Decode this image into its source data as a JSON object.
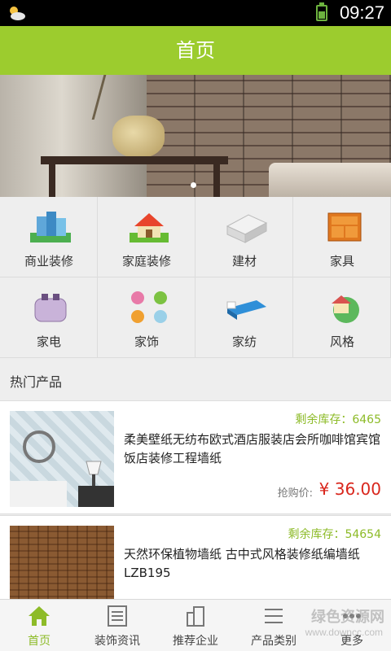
{
  "status_bar": {
    "time": "09:27"
  },
  "header": {
    "title": "首页"
  },
  "categories": [
    {
      "label": "商业装修",
      "icon": "buildings-icon"
    },
    {
      "label": "家庭装修",
      "icon": "house-icon"
    },
    {
      "label": "建材",
      "icon": "building-materials-icon"
    },
    {
      "label": "家具",
      "icon": "cabinet-icon"
    },
    {
      "label": "家电",
      "icon": "toaster-icon"
    },
    {
      "label": "家饰",
      "icon": "tree-art-icon"
    },
    {
      "label": "家纺",
      "icon": "bed-icon"
    },
    {
      "label": "风格",
      "icon": "globe-house-icon"
    }
  ],
  "hot_section": {
    "title": "热门产品"
  },
  "products": [
    {
      "stock": "剩余库存：6465",
      "name": "柔美壁纸无纺布欧式酒店服装店会所咖啡馆宾馆饭店装修工程墙纸",
      "price_label": "抢购价:",
      "price": "¥ 36.00"
    },
    {
      "stock": "剩余库存：54654",
      "name": "天然环保植物墙纸 古中式风格装修纸编墙纸 LZB195",
      "price_label": "",
      "price": ""
    }
  ],
  "tabs": [
    {
      "label": "首页",
      "icon": "home-icon"
    },
    {
      "label": "装饰资讯",
      "icon": "news-icon"
    },
    {
      "label": "推荐企业",
      "icon": "company-icon"
    },
    {
      "label": "产品类别",
      "icon": "list-icon"
    },
    {
      "label": "更多",
      "icon": "more-icon"
    }
  ],
  "watermark": {
    "text": "绿色资源网",
    "url": "www.downcc.com"
  },
  "colors": {
    "accent": "#9ccc2e",
    "price": "#d9261c",
    "stock": "#8dbb28"
  }
}
